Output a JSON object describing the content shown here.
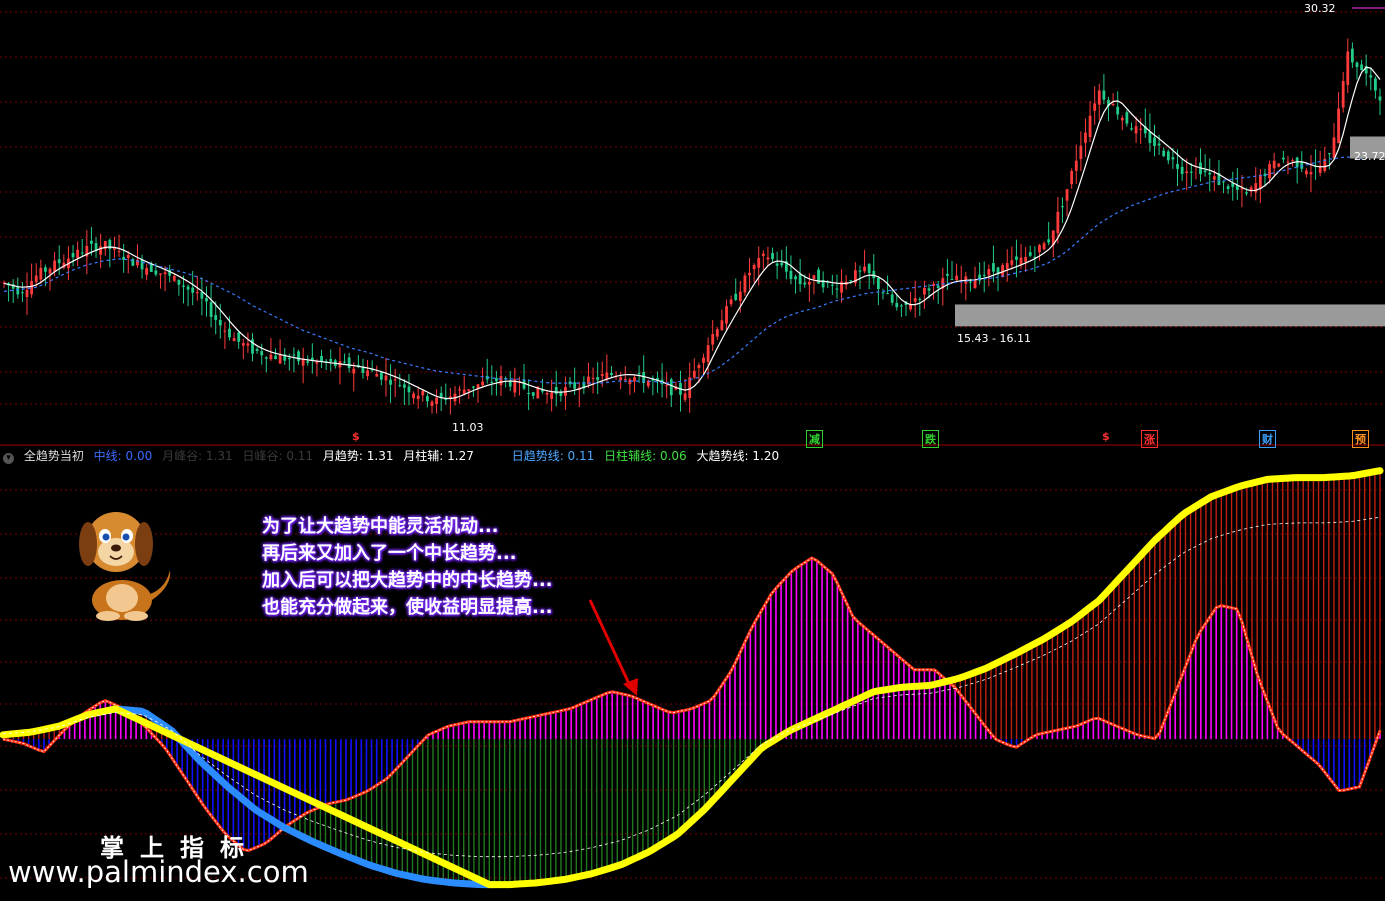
{
  "colors": {
    "background": "#000000",
    "grid": "#7a0000",
    "magenta_bars": "#ff00ff",
    "blue_bars": "#1010ff",
    "green_bars": "#1f7a1f",
    "darkred_bars": "#c02010",
    "yellow_line": "#ffff00",
    "light_blue_line": "#2a8cff",
    "ma_dashed": "#3a7aff"
  },
  "price_panel": {
    "high_label": "30.32",
    "low_label": "11.03",
    "range_label": "15.43 - 16.11",
    "right_label": "23.72",
    "signals": [
      {
        "text": "$",
        "color": "#ff3030"
      },
      {
        "text": "减",
        "color": "#30d030"
      },
      {
        "text": "跌",
        "color": "#30d030"
      },
      {
        "text": "$",
        "color": "#ff3030"
      },
      {
        "text": "涨",
        "color": "#ff3030"
      },
      {
        "text": "财",
        "color": "#3aa0ff"
      },
      {
        "text": "预",
        "color": "#ff9020"
      }
    ]
  },
  "legend": {
    "title": "全趋势当初",
    "items": [
      {
        "text": "中线: 0.00",
        "color": "#3a6aff"
      },
      {
        "text": "月峰谷: 1.31",
        "color": "#3a3a3a"
      },
      {
        "text": "日峰谷: 0.11",
        "color": "#3a3a3a"
      },
      {
        "text": "月趋势: 1.31",
        "color": "#ffffff"
      },
      {
        "text": "月柱辅: 1.27",
        "color": "#ffffff"
      },
      {
        "text": "日趋势线: 0.11",
        "color": "#4aa8ff"
      },
      {
        "text": "日柱辅线: 0.06",
        "color": "#40e040"
      },
      {
        "text": "大趋势线: 1.20",
        "color": "#ffffff"
      }
    ]
  },
  "callout": {
    "lines": [
      "为了让大趋势中能灵活机动...",
      "再后来又加入了一个中长趋势...",
      "加入后可以把大趋势中的中长趋势...",
      "也能充分做起来，使收益明显提高..."
    ]
  },
  "watermark": {
    "title": "掌上指标",
    "url": "www.palmindex.com"
  },
  "chart_data": [
    {
      "type": "candlestick",
      "ylim": [
        10,
        31
      ],
      "close": [
        17.2,
        16.8,
        17.6,
        18.1,
        18.5,
        18.9,
        19.1,
        18.6,
        18.2,
        17.9,
        17.5,
        17.0,
        16.3,
        15.2,
        14.4,
        13.9,
        13.7,
        13.5,
        13.4,
        13.3,
        13.2,
        13.1,
        12.9,
        12.6,
        12.2,
        11.8,
        11.4,
        11.7,
        12.1,
        12.3,
        12.5,
        12.2,
        11.9,
        11.8,
        12.0,
        12.3,
        12.6,
        12.8,
        12.6,
        12.4,
        12.0,
        11.8,
        13.5,
        15.1,
        16.4,
        17.8,
        18.6,
        17.9,
        17.2,
        17.4,
        17.0,
        17.5,
        17.8,
        16.8,
        15.8,
        16.5,
        17.1,
        17.4,
        17.3,
        17.6,
        17.9,
        18.2,
        18.6,
        19.3,
        21.5,
        24.2,
        26.7,
        25.8,
        24.9,
        24.3,
        23.6,
        22.8,
        22.9,
        22.3,
        21.9,
        21.5,
        22.6,
        23.3,
        23.1,
        22.7,
        23.4,
        28.4,
        27.6,
        26.4
      ],
      "ma_long": [
        16.8,
        16.9,
        17.0,
        17.4,
        17.8,
        18.1,
        18.3,
        18.4,
        18.3,
        18.1,
        17.9,
        17.7,
        17.4,
        17.0,
        16.6,
        16.1,
        15.7,
        15.3,
        14.9,
        14.6,
        14.3,
        14.0,
        13.8,
        13.5,
        13.3,
        13.1,
        12.9,
        12.8,
        12.7,
        12.6,
        12.5,
        12.5,
        12.4,
        12.3,
        12.3,
        12.3,
        12.3,
        12.4,
        12.4,
        12.4,
        12.3,
        12.4,
        12.6,
        13.0,
        13.6,
        14.3,
        15.0,
        15.5,
        15.8,
        16.0,
        16.3,
        16.5,
        16.7,
        16.8,
        16.9,
        17.0,
        17.1,
        17.2,
        17.3,
        17.4,
        17.5,
        17.7,
        17.9,
        18.2,
        18.7,
        19.4,
        20.1,
        20.6,
        21.0,
        21.3,
        21.6,
        21.8,
        22.0,
        22.2,
        22.3,
        22.4,
        22.5,
        22.7,
        22.9,
        23.1,
        23.3,
        23.4,
        23.3,
        23.6
      ]
    },
    {
      "type": "bar",
      "ylim": [
        -1.8,
        3.2
      ],
      "zero": 0,
      "trend": [
        0.0,
        -0.05,
        -0.15,
        0.1,
        0.3,
        0.45,
        0.35,
        0.15,
        -0.1,
        -0.45,
        -0.8,
        -1.1,
        -1.3,
        -1.2,
        -1.0,
        -0.85,
        -0.75,
        -0.7,
        -0.6,
        -0.45,
        -0.2,
        0.05,
        0.15,
        0.2,
        0.2,
        0.2,
        0.25,
        0.3,
        0.35,
        0.45,
        0.55,
        0.5,
        0.4,
        0.3,
        0.35,
        0.45,
        0.8,
        1.3,
        1.7,
        1.95,
        2.1,
        1.9,
        1.4,
        1.2,
        1.0,
        0.8,
        0.8,
        0.6,
        0.3,
        0.0,
        -0.1,
        0.05,
        0.1,
        0.15,
        0.25,
        0.15,
        0.05,
        0.0,
        0.6,
        1.2,
        1.55,
        1.5,
        0.7,
        0.1,
        -0.1,
        -0.3,
        -0.6,
        -0.55,
        0.1
      ],
      "big_trend": [
        0.05,
        0.08,
        0.15,
        0.28,
        0.35,
        0.32,
        0.1,
        -0.25,
        -0.55,
        -0.82,
        -1.02,
        -1.18,
        -1.32,
        -1.45,
        -1.55,
        -1.62,
        -1.66,
        -1.68,
        -1.68,
        -1.66,
        -1.62,
        -1.55,
        -1.45,
        -1.3,
        -1.1,
        -0.8,
        -0.45,
        -0.1,
        0.1,
        0.25,
        0.4,
        0.55,
        0.6,
        0.62,
        0.7,
        0.82,
        0.98,
        1.15,
        1.35,
        1.6,
        1.95,
        2.3,
        2.6,
        2.8,
        2.92,
        3.0,
        3.02,
        3.02,
        3.04,
        3.1
      ]
    }
  ]
}
